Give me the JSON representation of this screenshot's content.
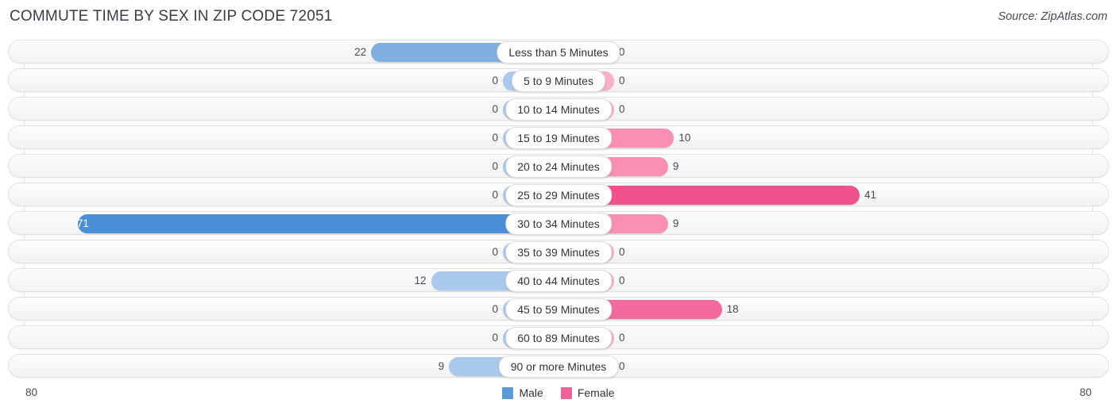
{
  "header": {
    "title": "COMMUTE TIME BY SEX IN ZIP CODE 72051",
    "source": "Source: ZipAtlas.com"
  },
  "axis": {
    "left_end": "80",
    "right_end": "80"
  },
  "legend": {
    "items": [
      {
        "label": "Male",
        "color": "#5b9bd5"
      },
      {
        "label": "Female",
        "color": "#f0629a"
      }
    ]
  },
  "chart_data": {
    "type": "bar",
    "title": "COMMUTE TIME BY SEX IN ZIP CODE 72051",
    "subtitle": "Source: ZipAtlas.com",
    "orientation": "horizontal-diverging",
    "xlabel": "",
    "ylabel": "",
    "xlim": [
      -80,
      80
    ],
    "axis_max": 80,
    "grid": true,
    "legend_position": "bottom-center",
    "categories": [
      "Less than 5 Minutes",
      "5 to 9 Minutes",
      "10 to 14 Minutes",
      "15 to 19 Minutes",
      "20 to 24 Minutes",
      "25 to 29 Minutes",
      "30 to 34 Minutes",
      "35 to 39 Minutes",
      "40 to 44 Minutes",
      "45 to 59 Minutes",
      "60 to 89 Minutes",
      "90 or more Minutes"
    ],
    "series": [
      {
        "name": "Male",
        "color": "#5b9bd5",
        "values": [
          22,
          0,
          0,
          0,
          0,
          0,
          71,
          0,
          12,
          0,
          0,
          9
        ]
      },
      {
        "name": "Female",
        "color": "#f0629a",
        "values": [
          0,
          0,
          0,
          10,
          9,
          41,
          9,
          0,
          0,
          18,
          0,
          0
        ]
      }
    ]
  },
  "rows": [
    {
      "label": "Less than 5 Minutes",
      "male": "22",
      "female": "0"
    },
    {
      "label": "5 to 9 Minutes",
      "male": "0",
      "female": "0"
    },
    {
      "label": "10 to 14 Minutes",
      "male": "0",
      "female": "0"
    },
    {
      "label": "15 to 19 Minutes",
      "male": "0",
      "female": "10"
    },
    {
      "label": "20 to 24 Minutes",
      "male": "0",
      "female": "9"
    },
    {
      "label": "25 to 29 Minutes",
      "male": "0",
      "female": "41"
    },
    {
      "label": "30 to 34 Minutes",
      "male": "71",
      "female": "9"
    },
    {
      "label": "35 to 39 Minutes",
      "male": "0",
      "female": "0"
    },
    {
      "label": "40 to 44 Minutes",
      "male": "12",
      "female": "0"
    },
    {
      "label": "45 to 59 Minutes",
      "male": "0",
      "female": "18"
    },
    {
      "label": "60 to 89 Minutes",
      "male": "0",
      "female": "0"
    },
    {
      "label": "90 or more Minutes",
      "male": "9",
      "female": "0"
    }
  ]
}
